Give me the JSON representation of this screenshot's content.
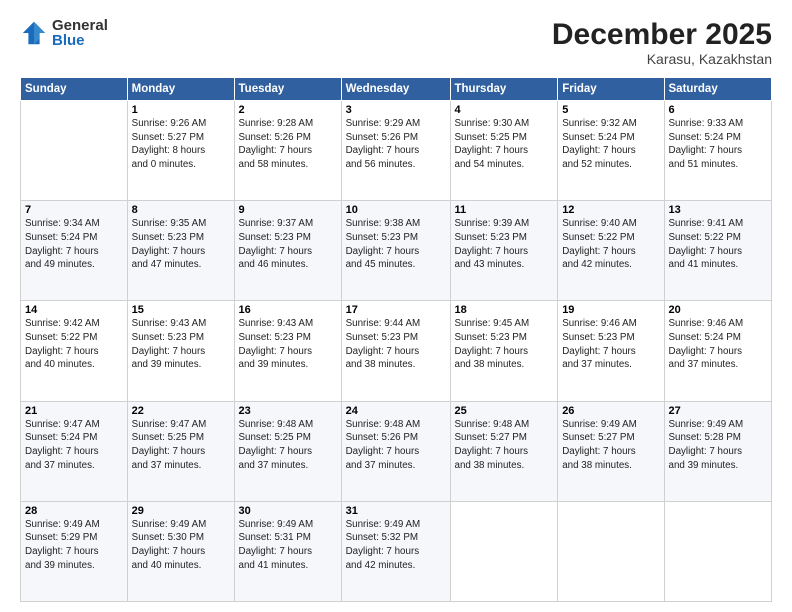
{
  "logo": {
    "general": "General",
    "blue": "Blue"
  },
  "header": {
    "month": "December 2025",
    "location": "Karasu, Kazakhstan"
  },
  "weekdays": [
    "Sunday",
    "Monday",
    "Tuesday",
    "Wednesday",
    "Thursday",
    "Friday",
    "Saturday"
  ],
  "weeks": [
    [
      {
        "day": "",
        "info": ""
      },
      {
        "day": "1",
        "info": "Sunrise: 9:26 AM\nSunset: 5:27 PM\nDaylight: 8 hours\nand 0 minutes."
      },
      {
        "day": "2",
        "info": "Sunrise: 9:28 AM\nSunset: 5:26 PM\nDaylight: 7 hours\nand 58 minutes."
      },
      {
        "day": "3",
        "info": "Sunrise: 9:29 AM\nSunset: 5:26 PM\nDaylight: 7 hours\nand 56 minutes."
      },
      {
        "day": "4",
        "info": "Sunrise: 9:30 AM\nSunset: 5:25 PM\nDaylight: 7 hours\nand 54 minutes."
      },
      {
        "day": "5",
        "info": "Sunrise: 9:32 AM\nSunset: 5:24 PM\nDaylight: 7 hours\nand 52 minutes."
      },
      {
        "day": "6",
        "info": "Sunrise: 9:33 AM\nSunset: 5:24 PM\nDaylight: 7 hours\nand 51 minutes."
      }
    ],
    [
      {
        "day": "7",
        "info": "Sunrise: 9:34 AM\nSunset: 5:24 PM\nDaylight: 7 hours\nand 49 minutes."
      },
      {
        "day": "8",
        "info": "Sunrise: 9:35 AM\nSunset: 5:23 PM\nDaylight: 7 hours\nand 47 minutes."
      },
      {
        "day": "9",
        "info": "Sunrise: 9:37 AM\nSunset: 5:23 PM\nDaylight: 7 hours\nand 46 minutes."
      },
      {
        "day": "10",
        "info": "Sunrise: 9:38 AM\nSunset: 5:23 PM\nDaylight: 7 hours\nand 45 minutes."
      },
      {
        "day": "11",
        "info": "Sunrise: 9:39 AM\nSunset: 5:23 PM\nDaylight: 7 hours\nand 43 minutes."
      },
      {
        "day": "12",
        "info": "Sunrise: 9:40 AM\nSunset: 5:22 PM\nDaylight: 7 hours\nand 42 minutes."
      },
      {
        "day": "13",
        "info": "Sunrise: 9:41 AM\nSunset: 5:22 PM\nDaylight: 7 hours\nand 41 minutes."
      }
    ],
    [
      {
        "day": "14",
        "info": "Sunrise: 9:42 AM\nSunset: 5:22 PM\nDaylight: 7 hours\nand 40 minutes."
      },
      {
        "day": "15",
        "info": "Sunrise: 9:43 AM\nSunset: 5:23 PM\nDaylight: 7 hours\nand 39 minutes."
      },
      {
        "day": "16",
        "info": "Sunrise: 9:43 AM\nSunset: 5:23 PM\nDaylight: 7 hours\nand 39 minutes."
      },
      {
        "day": "17",
        "info": "Sunrise: 9:44 AM\nSunset: 5:23 PM\nDaylight: 7 hours\nand 38 minutes."
      },
      {
        "day": "18",
        "info": "Sunrise: 9:45 AM\nSunset: 5:23 PM\nDaylight: 7 hours\nand 38 minutes."
      },
      {
        "day": "19",
        "info": "Sunrise: 9:46 AM\nSunset: 5:23 PM\nDaylight: 7 hours\nand 37 minutes."
      },
      {
        "day": "20",
        "info": "Sunrise: 9:46 AM\nSunset: 5:24 PM\nDaylight: 7 hours\nand 37 minutes."
      }
    ],
    [
      {
        "day": "21",
        "info": "Sunrise: 9:47 AM\nSunset: 5:24 PM\nDaylight: 7 hours\nand 37 minutes."
      },
      {
        "day": "22",
        "info": "Sunrise: 9:47 AM\nSunset: 5:25 PM\nDaylight: 7 hours\nand 37 minutes."
      },
      {
        "day": "23",
        "info": "Sunrise: 9:48 AM\nSunset: 5:25 PM\nDaylight: 7 hours\nand 37 minutes."
      },
      {
        "day": "24",
        "info": "Sunrise: 9:48 AM\nSunset: 5:26 PM\nDaylight: 7 hours\nand 37 minutes."
      },
      {
        "day": "25",
        "info": "Sunrise: 9:48 AM\nSunset: 5:27 PM\nDaylight: 7 hours\nand 38 minutes."
      },
      {
        "day": "26",
        "info": "Sunrise: 9:49 AM\nSunset: 5:27 PM\nDaylight: 7 hours\nand 38 minutes."
      },
      {
        "day": "27",
        "info": "Sunrise: 9:49 AM\nSunset: 5:28 PM\nDaylight: 7 hours\nand 39 minutes."
      }
    ],
    [
      {
        "day": "28",
        "info": "Sunrise: 9:49 AM\nSunset: 5:29 PM\nDaylight: 7 hours\nand 39 minutes."
      },
      {
        "day": "29",
        "info": "Sunrise: 9:49 AM\nSunset: 5:30 PM\nDaylight: 7 hours\nand 40 minutes."
      },
      {
        "day": "30",
        "info": "Sunrise: 9:49 AM\nSunset: 5:31 PM\nDaylight: 7 hours\nand 41 minutes."
      },
      {
        "day": "31",
        "info": "Sunrise: 9:49 AM\nSunset: 5:32 PM\nDaylight: 7 hours\nand 42 minutes."
      },
      {
        "day": "",
        "info": ""
      },
      {
        "day": "",
        "info": ""
      },
      {
        "day": "",
        "info": ""
      }
    ]
  ]
}
